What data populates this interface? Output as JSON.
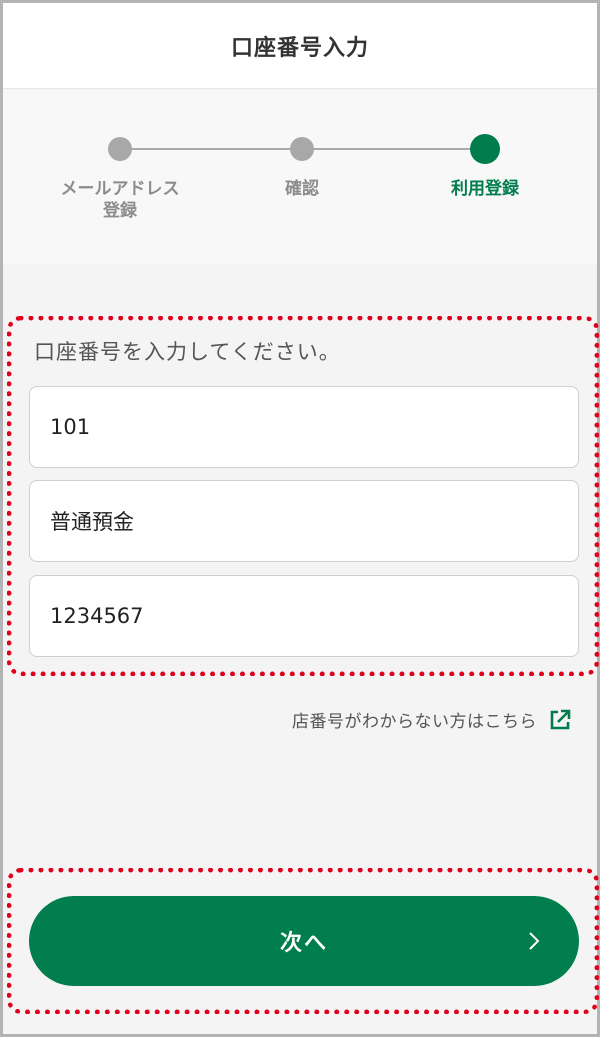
{
  "header": {
    "title": "口座番号入力"
  },
  "stepper": {
    "steps": [
      {
        "label": "メールアドレス\n登録",
        "line1": "メールアドレス",
        "line2": "登録",
        "state": "done"
      },
      {
        "label": "確認",
        "state": "done"
      },
      {
        "label": "利用登録",
        "state": "current"
      }
    ]
  },
  "form": {
    "prompt": "口座番号を入力してください。",
    "branch_value": "101",
    "account_type_value": "普通預金",
    "account_number_value": "1234567"
  },
  "help_link": {
    "label": "店番号がわからない方はこちら",
    "icon": "external-link-icon"
  },
  "next_button": {
    "label": "次へ",
    "icon": "chevron-right-icon"
  },
  "colors": {
    "accent": "#007c4d",
    "highlight": "#e0001b",
    "inactive": "#a8a8a8"
  }
}
